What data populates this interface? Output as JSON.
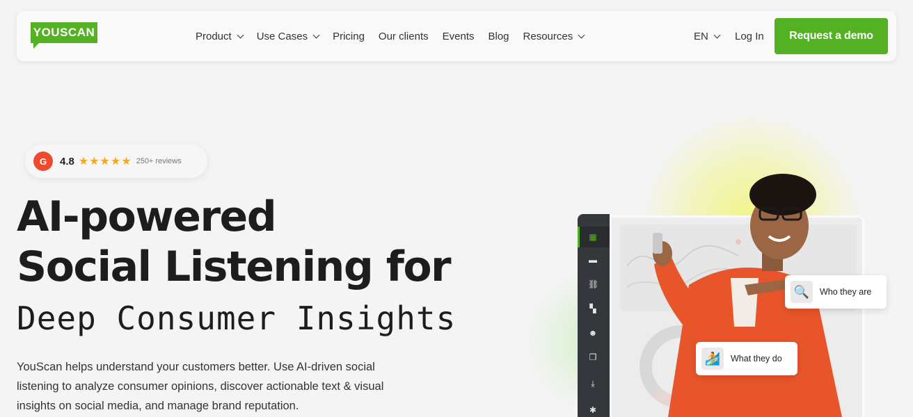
{
  "nav": {
    "logo": "YOUSCAN",
    "menu": [
      {
        "label": "Product",
        "dropdown": true
      },
      {
        "label": "Use Cases",
        "dropdown": true
      },
      {
        "label": "Pricing",
        "dropdown": false
      },
      {
        "label": "Our clients",
        "dropdown": false
      },
      {
        "label": "Events",
        "dropdown": false
      },
      {
        "label": "Blog",
        "dropdown": false
      },
      {
        "label": "Resources",
        "dropdown": true
      }
    ],
    "language": "EN",
    "login": "Log In",
    "cta": "Request a demo"
  },
  "rating": {
    "badge": "G",
    "score": "4.8",
    "stars": "★★★★★",
    "reviews": "250+ reviews"
  },
  "hero": {
    "title_line1": "AI-powered",
    "title_line2": "Social Listening for",
    "title_line3": "Deep Consumer Insights",
    "description": "YouScan helps understand your customers better. Use AI-driven social listening to analyze consumer opinions, discover actionable text & visual insights on social media, and manage brand reputation."
  },
  "visual": {
    "card_who": "Who they are",
    "card_what": "What they do"
  },
  "colors": {
    "brand_green": "#54b124",
    "g2_red": "#ef4a2e",
    "star": "#f5a623",
    "jacket": "#e8552a"
  }
}
